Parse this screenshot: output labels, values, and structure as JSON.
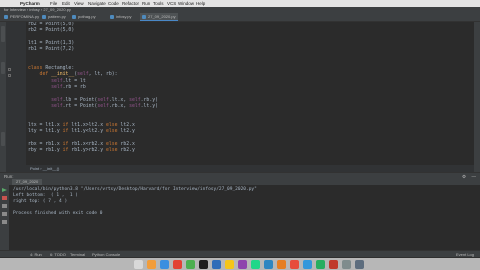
{
  "menubar": {
    "apple": "",
    "app": "PyCharm",
    "items": [
      "File",
      "Edit",
      "View",
      "Navigate",
      "Code",
      "Refactor",
      "Run",
      "Tools",
      "VCS",
      "Window",
      "Help"
    ],
    "right": ""
  },
  "nav": {
    "text": "for Interview  ›  infosy  ›  27_09_2020.py"
  },
  "tabs": [
    {
      "label": "PERFOMINA.py"
    },
    {
      "label": "pattern.py"
    },
    {
      "label": "pothag.py"
    },
    {
      "label": "infosy.py"
    },
    {
      "label": "27_09_2020.py"
    }
  ],
  "editor": {
    "lines": [
      [
        {
          "t": "rb2 = Point(5,0)",
          "c": ""
        }
      ],
      [
        {
          "t": "rb2 = Point(5,0)",
          "c": ""
        }
      ],
      [
        {
          "t": "",
          "c": ""
        }
      ],
      [
        {
          "t": "lt1 = Point(1,3)",
          "c": ""
        }
      ],
      [
        {
          "t": "rb1 = Point(7,2)",
          "c": ""
        }
      ],
      [
        {
          "t": "",
          "c": ""
        }
      ],
      [
        {
          "t": "",
          "c": ""
        }
      ],
      [
        {
          "t": "class ",
          "c": "kw"
        },
        {
          "t": "Rectangle:",
          "c": ""
        }
      ],
      [
        {
          "t": "    def ",
          "c": "kw"
        },
        {
          "t": "__init__",
          "c": "fn"
        },
        {
          "t": "(",
          "c": ""
        },
        {
          "t": "self",
          "c": "slf"
        },
        {
          "t": ", lt, rb):",
          "c": ""
        }
      ],
      [
        {
          "t": "        self",
          "c": "slf"
        },
        {
          "t": ".lt = lt",
          "c": ""
        }
      ],
      [
        {
          "t": "        self",
          "c": "slf"
        },
        {
          "t": ".rb = rb",
          "c": ""
        }
      ],
      [
        {
          "t": "",
          "c": ""
        }
      ],
      [
        {
          "t": "        self",
          "c": "slf"
        },
        {
          "t": ".lb = Point(",
          "c": ""
        },
        {
          "t": "self",
          "c": "slf"
        },
        {
          "t": ".lt.x, ",
          "c": ""
        },
        {
          "t": "self",
          "c": "slf"
        },
        {
          "t": ".rb.y)",
          "c": ""
        }
      ],
      [
        {
          "t": "        self",
          "c": "slf"
        },
        {
          "t": ".rt = Point(",
          "c": ""
        },
        {
          "t": "self",
          "c": "slf"
        },
        {
          "t": ".rb.x, ",
          "c": ""
        },
        {
          "t": "self",
          "c": "slf"
        },
        {
          "t": ".lt.y)",
          "c": ""
        }
      ],
      [
        {
          "t": "",
          "c": ""
        }
      ],
      [
        {
          "t": "",
          "c": ""
        }
      ],
      [
        {
          "t": "ltx = lt1.x ",
          "c": ""
        },
        {
          "t": "if ",
          "c": "kw"
        },
        {
          "t": "lt1.x>lt2.x ",
          "c": ""
        },
        {
          "t": "else ",
          "c": "kw"
        },
        {
          "t": "lt2.x",
          "c": ""
        }
      ],
      [
        {
          "t": "lty = lt1.y ",
          "c": ""
        },
        {
          "t": "if ",
          "c": "kw"
        },
        {
          "t": "lt1.y<lt2.y ",
          "c": ""
        },
        {
          "t": "else ",
          "c": "kw"
        },
        {
          "t": "lt2.y",
          "c": ""
        }
      ],
      [
        {
          "t": "",
          "c": ""
        }
      ],
      [
        {
          "t": "rbx = rb1.x ",
          "c": ""
        },
        {
          "t": "if ",
          "c": "kw"
        },
        {
          "t": "rb1.x<rb2.x ",
          "c": ""
        },
        {
          "t": "else ",
          "c": "kw"
        },
        {
          "t": "rb2.x",
          "c": ""
        }
      ],
      [
        {
          "t": "rby = rb1.y ",
          "c": ""
        },
        {
          "t": "if ",
          "c": "kw"
        },
        {
          "t": "rb1.y>rb2.y ",
          "c": ""
        },
        {
          "t": "else ",
          "c": "kw"
        },
        {
          "t": "rb2.y",
          "c": ""
        }
      ]
    ],
    "breadcrumb": "Point  ›  __init__()"
  },
  "run": {
    "label": "Run:",
    "tab": "27_09_2020",
    "console": [
      "/usr/local/bin/python3.8 \"/Users/vrtsy/Desktop/Harvard/for Interview/infosy/27_09_2020.py\"",
      "Left bottom:  ( 1 ,  1 )",
      "right top: ( 7 , 4 )",
      "",
      "Process finished with exit code 0"
    ]
  },
  "bottombar": {
    "items": [
      "4: Run",
      "6: TODO",
      "Terminal",
      "Python Console"
    ],
    "event_log": "Event Log"
  },
  "status": {
    "left": "PyCharm 2020.1.4 available // Update... (yesterday 10:30 PM)",
    "right": "17:6   LF   UTF-8   4 spaces   Python 3.8"
  }
}
